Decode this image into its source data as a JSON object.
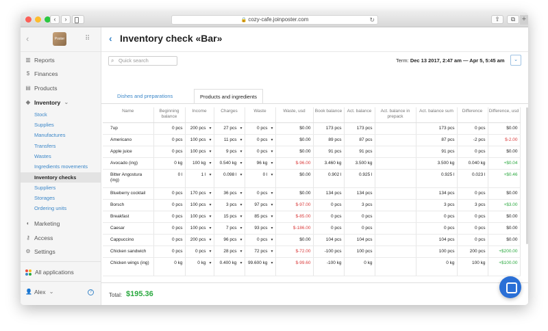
{
  "browser": {
    "url": "cozy-cafe.joinposter.com",
    "nav_back": "‹",
    "nav_forward": "›",
    "share": "⇧",
    "tabs": "⧉",
    "new_tab": "+"
  },
  "sidebar": {
    "logo_text": "Poster",
    "items": [
      {
        "label": "Reports",
        "icon": "▥"
      },
      {
        "label": "Finances",
        "icon": "$"
      },
      {
        "label": "Products",
        "icon": "▤"
      },
      {
        "label": "Inventory",
        "icon": "◈",
        "chevron": "⌄"
      }
    ],
    "inventory_sub": [
      {
        "label": "Stock"
      },
      {
        "label": "Supplies"
      },
      {
        "label": "Manufactures"
      },
      {
        "label": "Transfers"
      },
      {
        "label": "Wastes"
      },
      {
        "label": "Ingredients movements"
      },
      {
        "label": "Inventory checks"
      },
      {
        "label": "Suppliers"
      },
      {
        "label": "Storages"
      },
      {
        "label": "Ordering units"
      }
    ],
    "bottom_items": [
      {
        "label": "Marketing",
        "icon": "◐"
      },
      {
        "label": "Access",
        "icon": "⚷"
      },
      {
        "label": "Settings",
        "icon": "⚙"
      }
    ],
    "apps_label": "All applications",
    "user_name": "Alex",
    "user_chevron": "⌄",
    "help": "?"
  },
  "header": {
    "back": "‹",
    "title": "Inventory check «Bar»",
    "search_placeholder": "Quick search",
    "term_label": "Term:",
    "term_value": "Dec 13 2017, 2:47 am — Apr 5, 5:45 am",
    "date_chevron": "⌄"
  },
  "tabs": [
    {
      "label": "Dishes and preparations"
    },
    {
      "label": "Products and ingredients"
    }
  ],
  "table": {
    "columns": [
      "Name",
      "Beginning balance",
      "Income",
      "Charges",
      "Waste",
      "Waste, usd",
      "Book balance",
      "Act. balance",
      "Act. balance in prepack",
      "Act. balance sum",
      "Difference",
      "Difference, usd"
    ],
    "rows": [
      [
        "7up",
        "0 pcs",
        "200 pcs",
        "27 pcs",
        "0 pcs",
        "$0.00",
        "173 pcs",
        "173 pcs",
        "",
        "173 pcs",
        "0 pcs",
        "$0.00"
      ],
      [
        "Americano",
        "0 pcs",
        "100 pcs",
        "11 pcs",
        "0 pcs",
        "$0.00",
        "89 pcs",
        "87 pcs",
        "",
        "87 pcs",
        "-2 pcs",
        "$-2.00"
      ],
      [
        "Apple juice",
        "0 pcs",
        "100 pcs",
        "9 pcs",
        "0 pcs",
        "$0.00",
        "91 pcs",
        "91 pcs",
        "",
        "91 pcs",
        "0 pcs",
        "$0.00"
      ],
      [
        "Avocado (ing)",
        "0 kg",
        "100 kg",
        "0.540 kg",
        "96 kg",
        "$-96.00",
        "3.460 kg",
        "3.500 kg",
        "",
        "3.500 kg",
        "0.040 kg",
        "+$0.04"
      ],
      [
        "Bitter Angostura (ing)",
        "0 l",
        "1 l",
        "0.098 l",
        "0 l",
        "$0.00",
        "0.902 l",
        "0.925 l",
        "",
        "0.925 l",
        "0.023 l",
        "+$0.46"
      ],
      [
        "Blueberry cocktail",
        "0 pcs",
        "170 pcs",
        "36 pcs",
        "0 pcs",
        "$0.00",
        "134 pcs",
        "134 pcs",
        "",
        "134 pcs",
        "0 pcs",
        "$0.00"
      ],
      [
        "Borsch",
        "0 pcs",
        "100 pcs",
        "3 pcs",
        "97 pcs",
        "$-97.00",
        "0 pcs",
        "3 pcs",
        "",
        "3 pcs",
        "3 pcs",
        "+$3.00"
      ],
      [
        "Breakfast",
        "0 pcs",
        "100 pcs",
        "15 pcs",
        "85 pcs",
        "$-85.00",
        "0 pcs",
        "0 pcs",
        "",
        "0 pcs",
        "0 pcs",
        "$0.00"
      ],
      [
        "Caesar",
        "0 pcs",
        "100 pcs",
        "7 pcs",
        "93 pcs",
        "$-186.00",
        "0 pcs",
        "0 pcs",
        "",
        "0 pcs",
        "0 pcs",
        "$0.00"
      ],
      [
        "Cappuccino",
        "0 pcs",
        "200 pcs",
        "96 pcs",
        "0 pcs",
        "$0.00",
        "104 pcs",
        "104 pcs",
        "",
        "104 pcs",
        "0 pcs",
        "$0.00"
      ],
      [
        "Chicken sandwich",
        "0 pcs",
        "0 pcs",
        "28 pcs",
        "72 pcs",
        "$-72.00",
        "-100 pcs",
        "100 pcs",
        "",
        "100 pcs",
        "200 pcs",
        "+$200.00"
      ],
      [
        "Chicken wings (ing)",
        "0 kg",
        "0 kg",
        "0.400 kg",
        "99.600 kg",
        "$-99.60",
        "-100 kg",
        "0 kg",
        "",
        "0 kg",
        "100 kg",
        "+$100.00"
      ]
    ]
  },
  "footer": {
    "total_label": "Total:",
    "total_value": "$195.36"
  },
  "colors": {
    "accent": "#3a86c8",
    "positive": "#29a83e",
    "negative": "#d93a3a",
    "chat": "#2a6fd6"
  }
}
